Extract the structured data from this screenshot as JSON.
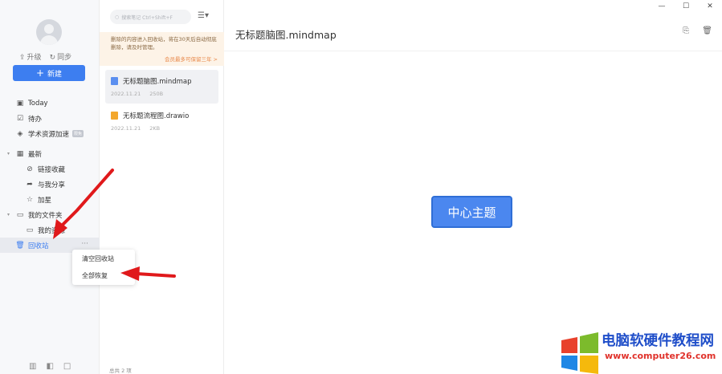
{
  "sidebar": {
    "upgrade_label": "升级",
    "sync_label": "同步",
    "new_button_label": "新建",
    "items": [
      {
        "label": "Today",
        "icon": "calendar-icon"
      },
      {
        "label": "待办",
        "icon": "checkbox-icon"
      },
      {
        "label": "学术资源加速",
        "icon": "rocket-icon",
        "badge": "限免"
      },
      {
        "label": "最新",
        "icon": "grid-icon"
      },
      {
        "label": "链接收藏",
        "icon": "link-icon"
      },
      {
        "label": "与我分享",
        "icon": "share-icon"
      },
      {
        "label": "加星",
        "icon": "star-icon"
      },
      {
        "label": "我的文件夹",
        "icon": "folder-icon"
      },
      {
        "label": "我的资源",
        "icon": "folder-icon"
      },
      {
        "label": "回收站",
        "icon": "trash-icon"
      }
    ],
    "more_label": "···"
  },
  "context_menu": {
    "items": [
      "清空回收站",
      "全部恢复"
    ]
  },
  "list": {
    "search_placeholder": "搜索笔记 Ctrl+Shift+F",
    "notice_text": "删除的内容进入回收站，将在30天后自动彻底删除，请及时管理。",
    "notice_link": "会员最多可保留三年 >",
    "files": [
      {
        "name": "无标题脑图.mindmap",
        "date": "2022.11.21",
        "size": "250B",
        "icon_color": "#5b8ff0"
      },
      {
        "name": "无标题流程图.drawio",
        "date": "2022.11.21",
        "size": "2KB",
        "icon_color": "#f3a72c"
      }
    ],
    "count_text": "总共 2 项"
  },
  "main": {
    "title": "无标题脑图.mindmap",
    "center_node": "中心主题"
  },
  "window_controls": [
    "—",
    "☐",
    "✕"
  ],
  "watermark": {
    "cn": "电脑软硬件教程网",
    "url": "www.computer26.com"
  },
  "colors": {
    "accent": "#3d7ef0",
    "node_fill": "#4b87ef",
    "arrow": "#e0191b",
    "notice_bg": "#fdf3e7"
  }
}
